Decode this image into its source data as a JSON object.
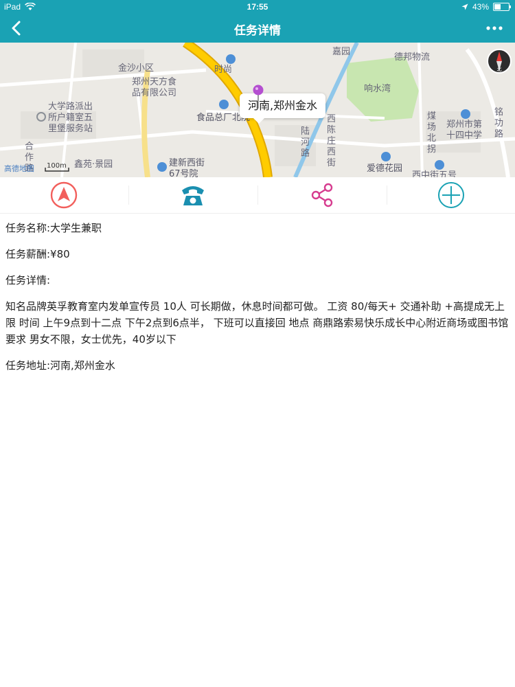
{
  "status_bar": {
    "device": "iPad",
    "time": "17:55",
    "battery_text": "43%",
    "battery_level": 0.43
  },
  "nav": {
    "title": "任务详情",
    "back_icon": "chevron-left-icon",
    "more_icon": "more-dots-icon"
  },
  "map": {
    "callout": "河南,郑州金水",
    "labels": {
      "jinsha": "金沙小区",
      "tianfang": "郑州天方食品有限公司",
      "daxuelu": "大学路派出所户籍室五里堡服务站",
      "shipin": "食品总厂北院",
      "hezuo": "合作路",
      "xinyuan": "鑫苑·景园",
      "jianxin": "建新西街67号院",
      "shishang": "时尚",
      "jiayuan": "嘉园",
      "debang": "德邦物流",
      "xiangshuiwan": "响水湾",
      "xichen": "西陈庄西街",
      "lujia": "陆河路",
      "meichang": "煤场北拐",
      "zhengzhou14": "郑州市第十四中学",
      "minggong": "铭功路",
      "aide": "爱德花园",
      "xizhong": "西中街五号",
      "gaode": "高德地图",
      "scale": "100m"
    },
    "compass_label": "北",
    "pin_color": "#b44fd0"
  },
  "actions": [
    {
      "name": "navigate",
      "icon": "navigation-icon",
      "color": "#f25f5c"
    },
    {
      "name": "call",
      "icon": "phone-icon",
      "color": "#1a8fb0"
    },
    {
      "name": "share",
      "icon": "share-icon",
      "color": "#d63c8f"
    },
    {
      "name": "add",
      "icon": "plus-circle-icon",
      "color": "#1aa2b4"
    }
  ],
  "task": {
    "name_row": "任务名称:大学生兼职",
    "pay_row": "任务薪酬:¥80",
    "detail_label": "任务详情:",
    "detail_text": "知名品牌英孚教育室内发单宣传员 10人 可长期做，休息时间都可做。 工资 80/每天+ 交通补助 +高提成无上限 时间 上午9点到十二点 下午2点到6点半， 下班可以直接回 地点 商鼎路索易快乐成长中心附近商场或图书馆 要求 男女不限，女士优先，40岁以下",
    "address_row": "任务地址:河南,郑州金水"
  }
}
